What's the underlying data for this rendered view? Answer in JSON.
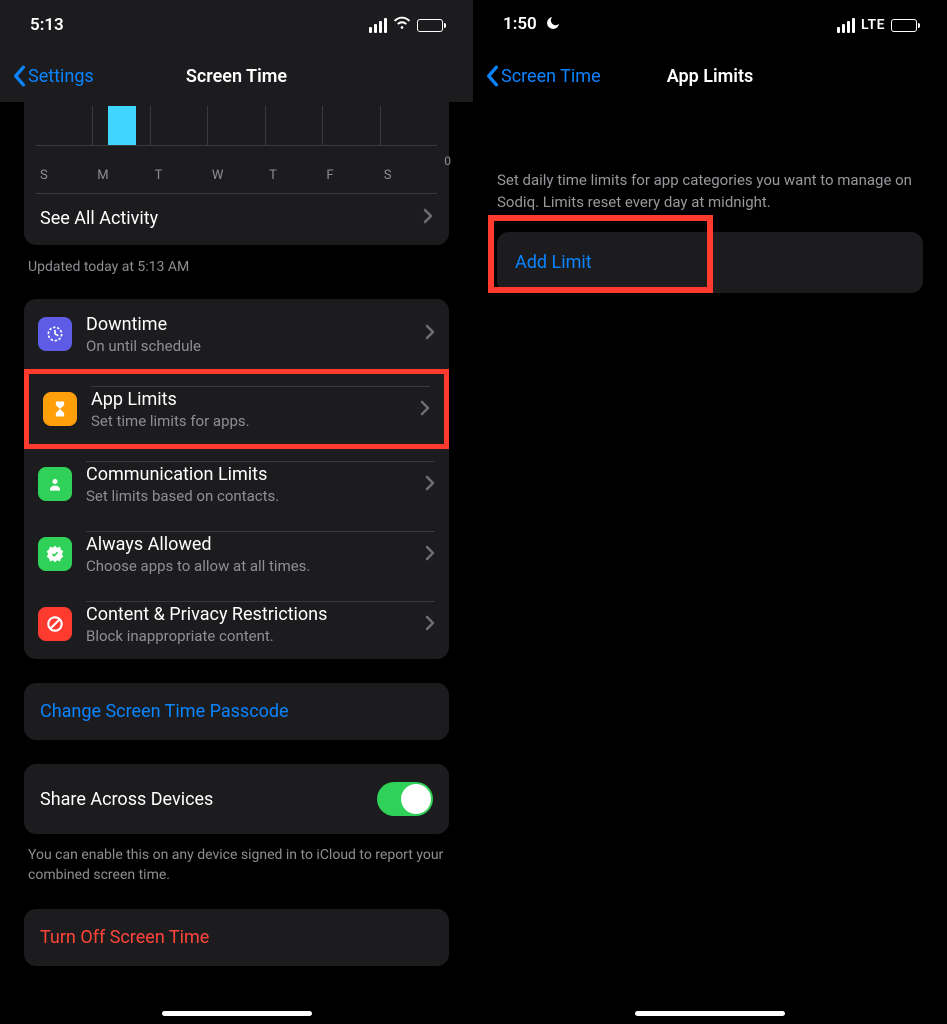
{
  "left": {
    "status": {
      "time": "5:13"
    },
    "nav": {
      "back": "Settings",
      "title": "Screen Time"
    },
    "chart": {
      "days": [
        "S",
        "M",
        "T",
        "W",
        "T",
        "F",
        "S"
      ],
      "zero": "0"
    },
    "see_all": "See All Activity",
    "updated": "Updated today at 5:13 AM",
    "rows": [
      {
        "title": "Downtime",
        "sub": "On until schedule"
      },
      {
        "title": "App Limits",
        "sub": "Set time limits for apps."
      },
      {
        "title": "Communication Limits",
        "sub": "Set limits based on contacts."
      },
      {
        "title": "Always Allowed",
        "sub": "Choose apps to allow at all times."
      },
      {
        "title": "Content & Privacy Restrictions",
        "sub": "Block inappropriate content."
      }
    ],
    "change_passcode": "Change Screen Time Passcode",
    "share_label": "Share Across Devices",
    "share_note": "You can enable this on any device signed in to iCloud to report your combined screen time.",
    "turn_off": "Turn Off Screen Time"
  },
  "right": {
    "status": {
      "time": "1:50",
      "net": "LTE"
    },
    "nav": {
      "back": "Screen Time",
      "title": "App Limits"
    },
    "desc": "Set daily time limits for app categories you want to manage on Sodiq. Limits reset every day at midnight.",
    "add": "Add Limit"
  },
  "chart_data": {
    "type": "bar",
    "categories": [
      "S",
      "M",
      "T",
      "W",
      "T",
      "F",
      "S"
    ],
    "values": [
      0,
      1,
      0,
      0,
      0,
      0,
      0
    ],
    "title": "",
    "xlabel": "",
    "ylabel": "",
    "ylim": [
      0,
      1
    ]
  }
}
